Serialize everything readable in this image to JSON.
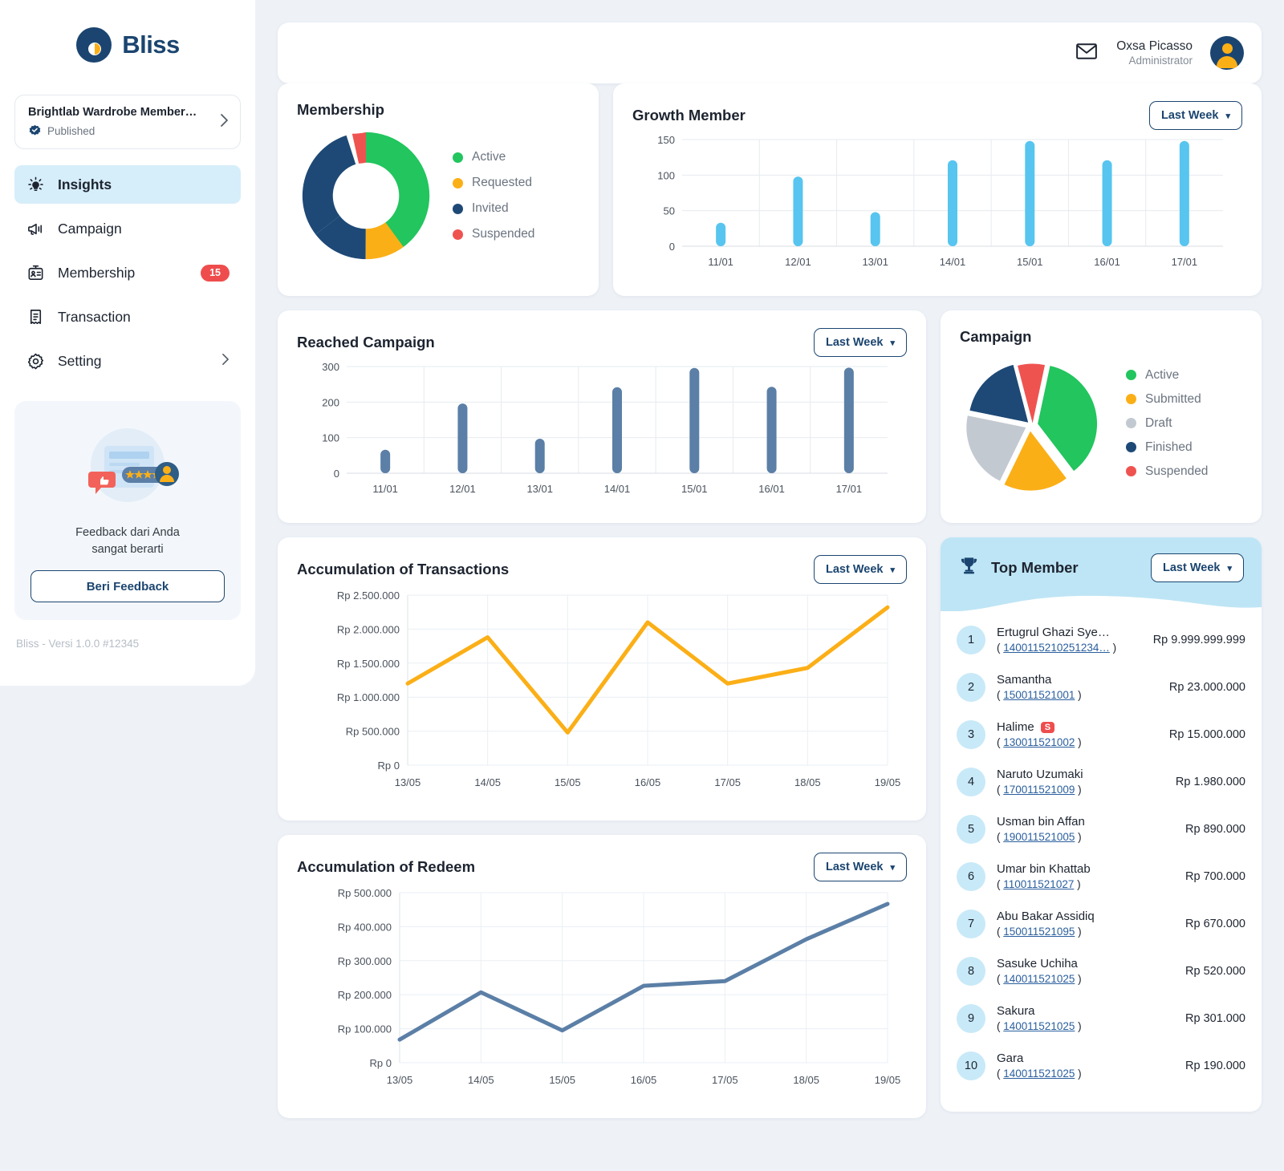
{
  "brand": {
    "name": "Bliss",
    "version": "Bliss - Versi 1.0.0 #12345"
  },
  "project": {
    "name": "Brightlab Wardrobe Member…",
    "status": "Published"
  },
  "sidebar": {
    "items": [
      {
        "label": "Insights",
        "icon": "lightbulb-icon",
        "active": true,
        "badge": ""
      },
      {
        "label": "Campaign",
        "icon": "megaphone-icon",
        "active": false,
        "badge": ""
      },
      {
        "label": "Membership",
        "icon": "id-card-icon",
        "active": false,
        "badge": "15"
      },
      {
        "label": "Transaction",
        "icon": "receipt-icon",
        "active": false,
        "badge": ""
      },
      {
        "label": "Setting",
        "icon": "gear-icon",
        "active": false,
        "badge": ""
      }
    ]
  },
  "feedback": {
    "text_line1": "Feedback dari Anda",
    "text_line2": "sangat berarti",
    "button": "Beri Feedback"
  },
  "header": {
    "user_name": "Oxsa Picasso",
    "user_role": "Administrator",
    "mail_icon": "mail-icon",
    "avatar_icon": "avatar-icon"
  },
  "dropdown_label": "Last Week",
  "cards": {
    "membership_title": "Membership",
    "growth_title": "Growth Member",
    "reached_title": "Reached Campaign",
    "campaign_title": "Campaign",
    "transactions_title": "Accumulation of Transactions",
    "redeem_title": "Accumulation of Redeem",
    "top_member_title": "Top Member"
  },
  "colors": {
    "green": "#22c55e",
    "orange": "#fbaf17",
    "navy": "#1e4976",
    "red": "#ef5350",
    "gray": "#c2c9d1",
    "sky": "#57c5ef",
    "steel": "#5b7fa6",
    "accent": "#1b4570",
    "badge_red": "#ef4d4d",
    "header_blue": "#bee5f5",
    "bg": "#eef2f7"
  },
  "chart_data": [
    {
      "type": "pie",
      "title": "Membership",
      "donut": true,
      "labels": [
        "Active",
        "Requested",
        "Invited",
        "Suspended"
      ],
      "values": [
        48,
        9,
        38,
        5
      ],
      "colors": [
        "#22c55e",
        "#fbaf17",
        "#1e4976",
        "#ef5350"
      ],
      "legend": "right"
    },
    {
      "type": "bar",
      "title": "Growth Member",
      "categories": [
        "11/01",
        "12/01",
        "13/01",
        "14/01",
        "15/01",
        "16/01",
        "17/01"
      ],
      "values": [
        33,
        98,
        48,
        121,
        148,
        121,
        148
      ],
      "yticks": [
        0,
        50,
        100,
        150
      ],
      "ylim": [
        0,
        150
      ],
      "xlabel": "",
      "ylabel": "",
      "grid": true,
      "color": "#57c5ef"
    },
    {
      "type": "bar",
      "title": "Reached Campaign",
      "categories": [
        "11/01",
        "12/01",
        "13/01",
        "14/01",
        "15/01",
        "16/01",
        "17/01"
      ],
      "values": [
        66,
        196,
        97,
        242,
        296,
        243,
        297
      ],
      "yticks": [
        0,
        100,
        200,
        300
      ],
      "ylim": [
        0,
        300
      ],
      "xlabel": "",
      "ylabel": "",
      "grid": true,
      "color": "#5b7fa6"
    },
    {
      "type": "pie",
      "title": "Campaign",
      "donut": false,
      "exploded": true,
      "labels": [
        "Active",
        "Submitted",
        "Draft",
        "Finished",
        "Suspended"
      ],
      "values": [
        36,
        21,
        14,
        17,
        12
      ],
      "colors": [
        "#22c55e",
        "#fbaf17",
        "#c2c9d1",
        "#1e4976",
        "#ef5350"
      ],
      "legend": "right"
    },
    {
      "type": "line",
      "title": "Accumulation of Transactions",
      "categories": [
        "13/05",
        "14/05",
        "15/05",
        "16/05",
        "17/05",
        "18/05",
        "19/05"
      ],
      "values": [
        1200000,
        1880000,
        480000,
        2100000,
        1200000,
        1430000,
        2320000
      ],
      "yticks": [
        0,
        500000,
        1000000,
        1500000,
        2000000,
        2500000
      ],
      "ytick_labels": [
        "Rp 0",
        "Rp 500.000",
        "Rp 1.000.000",
        "Rp 1.500.000",
        "Rp 2.000.000",
        "Rp 2.500.000"
      ],
      "ylim": [
        0,
        2500000
      ],
      "grid": true,
      "color": "#fbaf17"
    },
    {
      "type": "line",
      "title": "Accumulation of Redeem",
      "categories": [
        "13/05",
        "14/05",
        "15/05",
        "16/05",
        "17/05",
        "18/05",
        "19/05"
      ],
      "values": [
        68000,
        207000,
        95000,
        226000,
        240000,
        363000,
        467000
      ],
      "yticks": [
        0,
        100000,
        200000,
        300000,
        400000,
        500000
      ],
      "ytick_labels": [
        "Rp 0",
        "Rp 100.000",
        "Rp 200.000",
        "Rp 300.000",
        "Rp 400.000",
        "Rp 500.000"
      ],
      "ylim": [
        0,
        500000
      ],
      "grid": true,
      "color": "#5b7fa6"
    }
  ],
  "top_members": [
    {
      "rank": "1",
      "name": "Ertugrul Ghazi Sye…",
      "id": "1400115210251234…",
      "amount": "Rp 9.999.999.999",
      "flag": ""
    },
    {
      "rank": "2",
      "name": "Samantha",
      "id": "150011521001",
      "amount": "Rp 23.000.000",
      "flag": ""
    },
    {
      "rank": "3",
      "name": "Halime",
      "id": "130011521002",
      "amount": "Rp 15.000.000",
      "flag": "S"
    },
    {
      "rank": "4",
      "name": "Naruto Uzumaki",
      "id": "170011521009",
      "amount": "Rp 1.980.000",
      "flag": ""
    },
    {
      "rank": "5",
      "name": "Usman bin Affan",
      "id": "190011521005",
      "amount": "Rp 890.000",
      "flag": ""
    },
    {
      "rank": "6",
      "name": "Umar bin Khattab",
      "id": "110011521027",
      "amount": "Rp 700.000",
      "flag": ""
    },
    {
      "rank": "7",
      "name": "Abu Bakar Assidiq",
      "id": "150011521095",
      "amount": "Rp 670.000",
      "flag": ""
    },
    {
      "rank": "8",
      "name": "Sasuke Uchiha",
      "id": "140011521025",
      "amount": "Rp 520.000",
      "flag": ""
    },
    {
      "rank": "9",
      "name": "Sakura",
      "id": "140011521025",
      "amount": "Rp 301.000",
      "flag": ""
    },
    {
      "rank": "10",
      "name": "Gara",
      "id": "140011521025",
      "amount": "Rp 190.000",
      "flag": ""
    }
  ]
}
